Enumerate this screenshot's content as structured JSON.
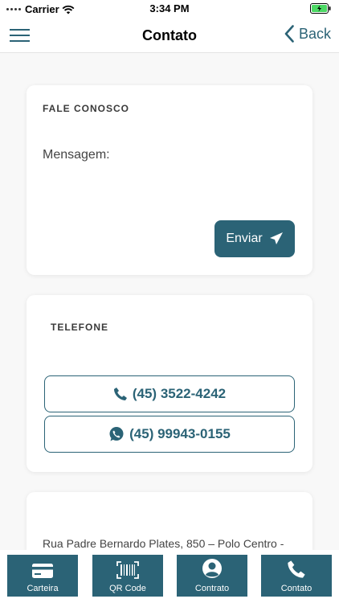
{
  "status_bar": {
    "carrier": "Carrier",
    "time": "3:34 PM"
  },
  "nav": {
    "title": "Contato",
    "back_label": "Back"
  },
  "contact_card": {
    "section_title": "FALE CONOSCO",
    "message_placeholder": "Mensagem:",
    "send_label": "Enviar"
  },
  "phone_card": {
    "section_title": "TELEFONE",
    "phone": "(45) 3522-4242",
    "whatsapp": "(45) 99943-0155"
  },
  "address_card": {
    "address": "Rua Padre Bernardo Plates, 850 – Polo Centro -"
  },
  "tabs": [
    {
      "label": "Carteira",
      "icon": "credit-card-icon"
    },
    {
      "label": "QR Code",
      "icon": "barcode-icon"
    },
    {
      "label": "Contrato",
      "icon": "user-circle-icon"
    },
    {
      "label": "Contato",
      "icon": "phone-icon"
    }
  ],
  "colors": {
    "accent": "#2b6376",
    "background": "#f8f8f8",
    "card": "#ffffff"
  }
}
